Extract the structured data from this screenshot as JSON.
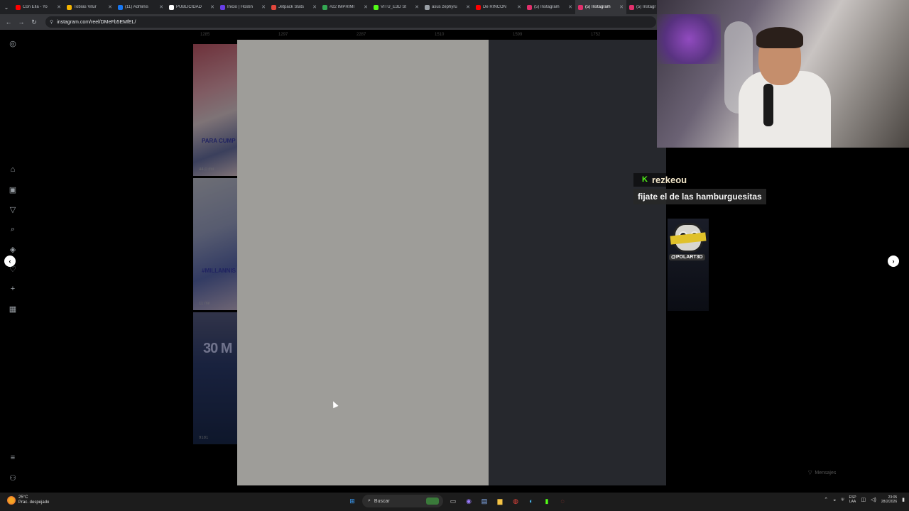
{
  "browser": {
    "tabs": [
      {
        "title": "Con Ella - Yo",
        "color": "#ff0000"
      },
      {
        "title": "Tobías Vitur",
        "color": "#f4b400"
      },
      {
        "title": "(11) Adminis",
        "color": "#1877f2"
      },
      {
        "title": "PUBLICIDAD",
        "color": "#ffffff"
      },
      {
        "title": "Inicio | Hostin",
        "color": "#673de6"
      },
      {
        "title": "Jetpack Stats",
        "color": "#e2473c"
      },
      {
        "title": "#22 IMPRIMI",
        "color": "#34a853"
      },
      {
        "title": "VITU_E3D St",
        "color": "#53fc18"
      },
      {
        "title": "asus zephyru",
        "color": "#9aa0a6"
      },
      {
        "title": "De RINCÓN",
        "color": "#ff0000"
      },
      {
        "title": "(5) Instagram",
        "color": "#e1306c"
      },
      {
        "title": "(5) Instagram",
        "color": "#e1306c"
      },
      {
        "title": "(5) Instagr",
        "color": "#e1306c"
      }
    ],
    "url": "instagram.com/reel/DMeFb5EMfEL/"
  },
  "reels_grid": {
    "top_counts": [
      "1285",
      "1297",
      "2287",
      "1510",
      "1599",
      "1752"
    ],
    "thumbs": [
      {
        "views": "44,0 mil",
        "overlay": "PARA CUMP"
      },
      {
        "views": "11 mil",
        "overlay": "#MILLANNIS"
      },
      {
        "views": "9181",
        "overlay": "30 M"
      }
    ]
  },
  "messages_label": "Mensajes",
  "chat": {
    "username": "rezkeou",
    "message": "fijate el de las hamburguesitas",
    "platform_badge": "K"
  },
  "mascot_tag": "@POLART3D",
  "taskbar": {
    "weather_temp": "25°C",
    "weather_desc": "Prac. despejado",
    "search_label": "Buscar",
    "lang_line1": "ESP",
    "lang_line2": "LAA",
    "time": "23:05",
    "date": "28/2/2026"
  }
}
